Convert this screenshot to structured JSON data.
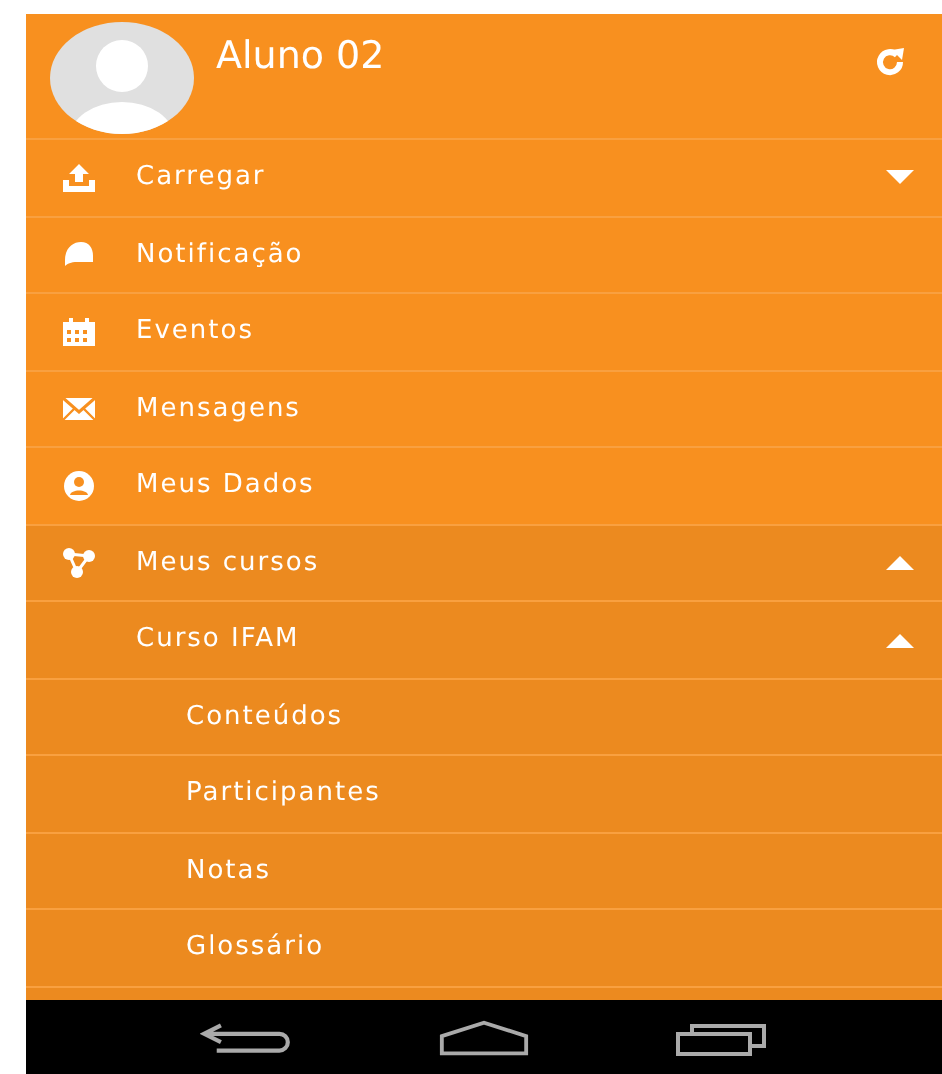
{
  "header": {
    "user_name": "Aluno 02"
  },
  "menu": [
    {
      "label": "Carregar",
      "expanded": false
    },
    {
      "label": "Notificação"
    },
    {
      "label": "Eventos"
    },
    {
      "label": "Mensagens"
    },
    {
      "label": "Meus Dados"
    },
    {
      "label": "Meus cursos",
      "expanded": true,
      "children": [
        {
          "label": "Curso IFAM",
          "expanded": true,
          "children": [
            {
              "label": "Conteúdos"
            },
            {
              "label": "Participantes"
            },
            {
              "label": "Notas"
            },
            {
              "label": "Glossário"
            }
          ]
        }
      ]
    }
  ]
}
